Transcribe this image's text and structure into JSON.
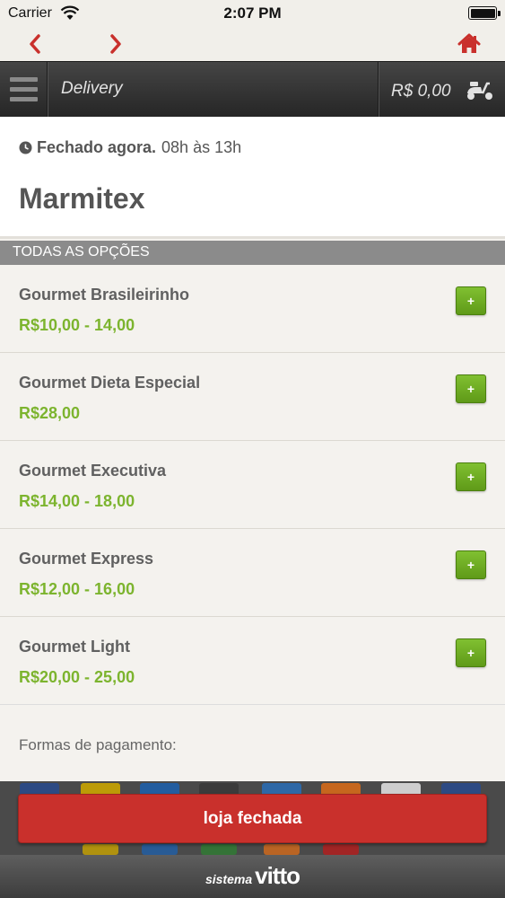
{
  "status_bar": {
    "carrier": "Carrier",
    "time": "2:07 PM"
  },
  "nav": {
    "back_icon": "chevron-left-icon",
    "forward_icon": "chevron-right-icon",
    "home_icon": "home-icon",
    "accent_color": "#c9302c"
  },
  "app_bar": {
    "title": "Delivery",
    "cart_total": "R$ 0,00",
    "cart_icon": "scooter-icon"
  },
  "store": {
    "status": "Fechado agora.",
    "hours": "08h às 13h",
    "name": "Marmitex"
  },
  "section": {
    "title": "TODAS AS OPÇÕES"
  },
  "products": [
    {
      "name": "Gourmet Brasileirinho",
      "price": "R$10,00 - 14,00",
      "add_label": "+"
    },
    {
      "name": "Gourmet Dieta Especial",
      "price": "R$28,00",
      "add_label": "+"
    },
    {
      "name": "Gourmet Executiva",
      "price": "R$14,00 - 18,00",
      "add_label": "+"
    },
    {
      "name": "Gourmet Express",
      "price": "R$12,00 - 16,00",
      "add_label": "+"
    },
    {
      "name": "Gourmet Light",
      "price": "R$20,00 - 25,00",
      "add_label": "+"
    }
  ],
  "payment": {
    "label": "Formas de pagamento:"
  },
  "action": {
    "label": "loja fechada",
    "color": "#c9302c"
  },
  "footer": {
    "prefix": "sistema",
    "brand": "vitto"
  },
  "colors": {
    "price_green": "#7cb42e",
    "add_button_green": "#6aaa22"
  }
}
